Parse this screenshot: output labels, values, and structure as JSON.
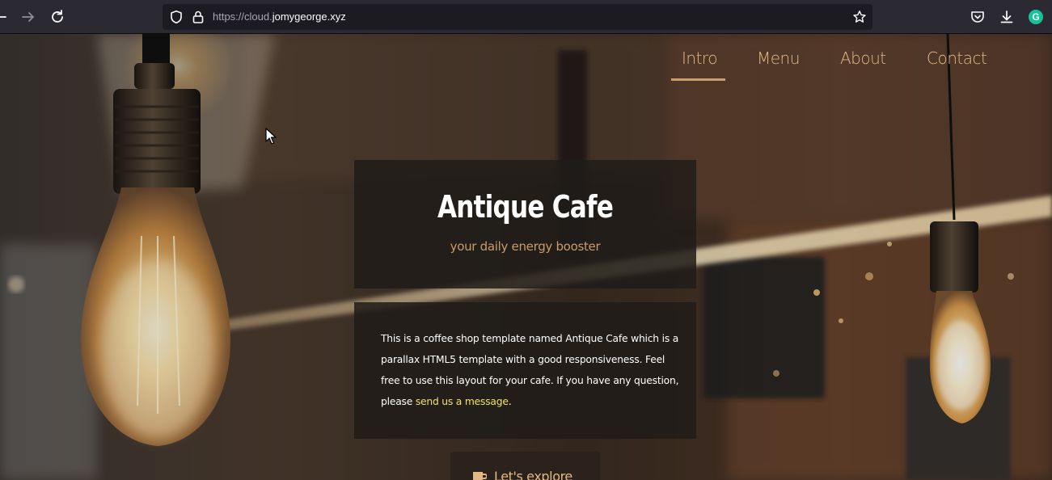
{
  "browser": {
    "url_prefix": "https://cloud.",
    "url_domain": "jomygeorge.xyz",
    "icons": {
      "back": "back-arrow-icon",
      "forward": "forward-arrow-icon",
      "reload": "reload-icon",
      "tracking": "shield-icon",
      "security": "lock-icon",
      "bookmark": "star-icon",
      "pocket": "pocket-icon",
      "downloads": "download-icon",
      "extension": "grammarly-icon"
    },
    "extension_letter": "G"
  },
  "nav": {
    "items": [
      {
        "label": "Intro",
        "active": true
      },
      {
        "label": "Menu",
        "active": false
      },
      {
        "label": "About",
        "active": false
      },
      {
        "label": "Contact",
        "active": false
      }
    ]
  },
  "hero": {
    "title": "Antique Cafe",
    "tagline": "your daily energy booster"
  },
  "description": {
    "text_before": "This is a coffee shop template named Antique Cafe which is a parallax HTML5 template with a good responsiveness. Feel free to use this layout for your cafe. If you have any question, please ",
    "link_text": "send us a message",
    "text_after": "."
  },
  "cta": {
    "label": "Let's explore",
    "icon": "coffee-cup-icon"
  },
  "colors": {
    "accent": "#c99c6b",
    "nav_text": "#e3b884",
    "link": "#f0e270",
    "panel": "#201c18",
    "browser_toolbar": "#2b2a33",
    "urlbar": "#1c1b22"
  }
}
